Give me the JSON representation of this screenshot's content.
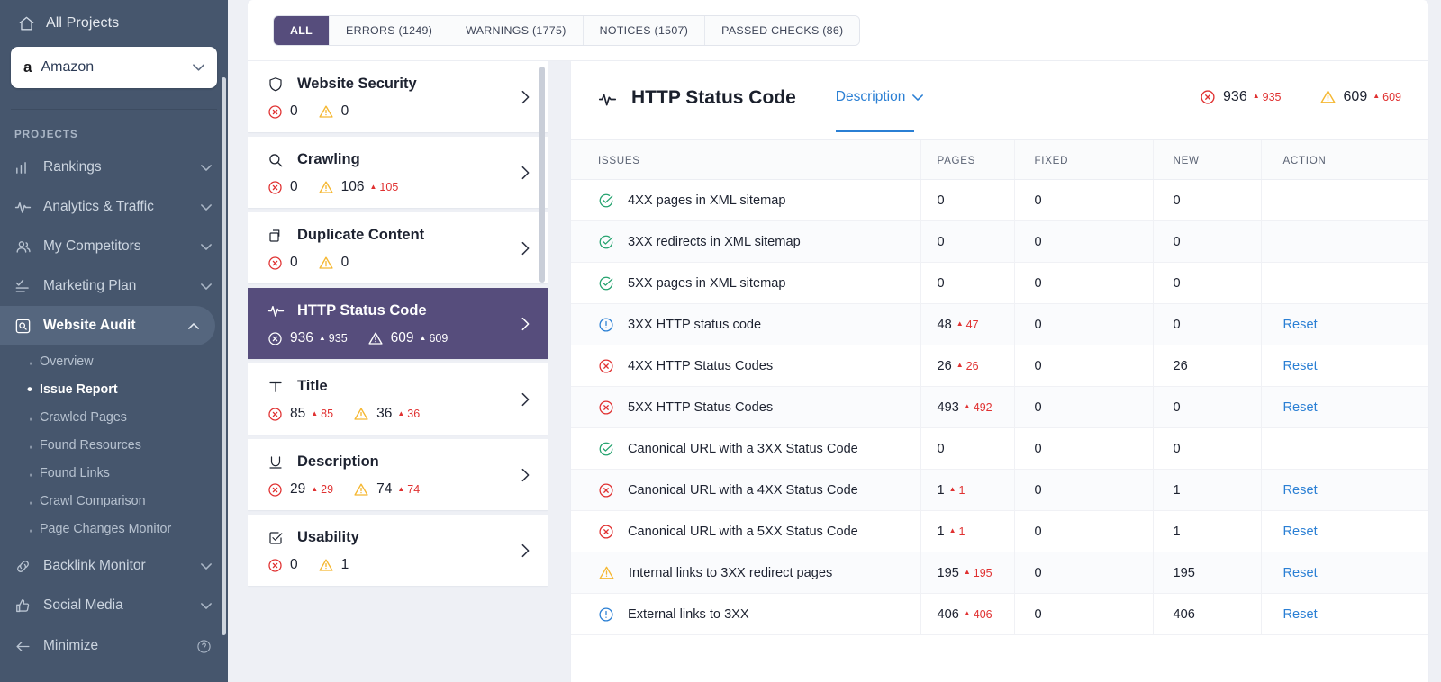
{
  "sidebar": {
    "all_projects_label": "All Projects",
    "project": {
      "name": "Amazon",
      "logo_text": "a"
    },
    "section_label": "PROJECTS",
    "nav": [
      {
        "label": "Rankings",
        "icon": "bar-chart-icon",
        "caret": "⌄"
      },
      {
        "label": "Analytics & Traffic",
        "icon": "pulse-icon",
        "caret": "⌄"
      },
      {
        "label": "My Competitors",
        "icon": "people-icon",
        "caret": "⌄"
      },
      {
        "label": "Marketing Plan",
        "icon": "checklist-icon",
        "caret": "⌄"
      },
      {
        "label": "Website Audit",
        "icon": "audit-search-icon",
        "caret": "⌃"
      }
    ],
    "audit_subnav": [
      {
        "label": "Overview",
        "current": false
      },
      {
        "label": "Issue Report",
        "current": true
      },
      {
        "label": "Crawled Pages",
        "current": false
      },
      {
        "label": "Found Resources",
        "current": false
      },
      {
        "label": "Found Links",
        "current": false
      },
      {
        "label": "Crawl Comparison",
        "current": false
      },
      {
        "label": "Page Changes Monitor",
        "current": false
      }
    ],
    "nav_bottom": [
      {
        "label": "Backlink Monitor",
        "icon": "link-icon",
        "caret": "⌄"
      },
      {
        "label": "Social Media",
        "icon": "thumbs-up-icon",
        "caret": "⌄"
      }
    ],
    "minimize_label": "Minimize",
    "help_icon": "help-circle-icon"
  },
  "tabs": [
    {
      "label": "ALL",
      "active": true
    },
    {
      "label": "ERRORS (1249)",
      "active": false
    },
    {
      "label": "WARNINGS (1775)",
      "active": false
    },
    {
      "label": "NOTICES (1507)",
      "active": false
    },
    {
      "label": "PASSED CHECKS (86)",
      "active": false
    }
  ],
  "categories": [
    {
      "name": "Website Security",
      "icon": "shield-icon",
      "selected": false,
      "errors": "0",
      "errors_delta": "",
      "warnings": "0",
      "warnings_delta": ""
    },
    {
      "name": "Crawling",
      "icon": "magnifier-icon",
      "selected": false,
      "errors": "0",
      "errors_delta": "",
      "warnings": "106",
      "warnings_delta": "105"
    },
    {
      "name": "Duplicate Content",
      "icon": "copy-icon",
      "selected": false,
      "errors": "0",
      "errors_delta": "",
      "warnings": "0",
      "warnings_delta": ""
    },
    {
      "name": "HTTP Status Code",
      "icon": "pulse-icon",
      "selected": true,
      "errors": "936",
      "errors_delta": "935",
      "warnings": "609",
      "warnings_delta": "609"
    },
    {
      "name": "Title",
      "icon": "text-t-icon",
      "selected": false,
      "errors": "85",
      "errors_delta": "85",
      "warnings": "36",
      "warnings_delta": "36"
    },
    {
      "name": "Description",
      "icon": "underline-u-icon",
      "selected": false,
      "errors": "29",
      "errors_delta": "29",
      "warnings": "74",
      "warnings_delta": "74"
    },
    {
      "name": "Usability",
      "icon": "checkbox-icon",
      "selected": false,
      "errors": "0",
      "errors_delta": "",
      "warnings": "1",
      "warnings_delta": ""
    }
  ],
  "detail": {
    "icon": "pulse-icon",
    "title": "HTTP Status Code",
    "tab_label": "Description",
    "errors": "936",
    "errors_delta": "935",
    "warnings": "609",
    "warnings_delta": "609",
    "columns": [
      "ISSUES",
      "PAGES",
      "FIXED",
      "NEW",
      "ACTION"
    ],
    "rows": [
      {
        "status": "ok",
        "issue": "4XX pages in XML sitemap",
        "pages": "0",
        "pages_delta": "",
        "fixed": "0",
        "new": "0",
        "action": ""
      },
      {
        "status": "ok",
        "issue": "3XX redirects in XML sitemap",
        "pages": "0",
        "pages_delta": "",
        "fixed": "0",
        "new": "0",
        "action": ""
      },
      {
        "status": "ok",
        "issue": "5XX pages in XML sitemap",
        "pages": "0",
        "pages_delta": "",
        "fixed": "0",
        "new": "0",
        "action": ""
      },
      {
        "status": "notice",
        "issue": "3XX HTTP status code",
        "pages": "48",
        "pages_delta": "47",
        "fixed": "0",
        "new": "0",
        "action": "Reset"
      },
      {
        "status": "error",
        "issue": "4XX HTTP Status Codes",
        "pages": "26",
        "pages_delta": "26",
        "fixed": "0",
        "new": "26",
        "action": "Reset"
      },
      {
        "status": "error",
        "issue": "5XX HTTP Status Codes",
        "pages": "493",
        "pages_delta": "492",
        "fixed": "0",
        "new": "0",
        "action": "Reset"
      },
      {
        "status": "ok",
        "issue": "Canonical URL with a 3XX Status Code",
        "pages": "0",
        "pages_delta": "",
        "fixed": "0",
        "new": "0",
        "action": ""
      },
      {
        "status": "error",
        "issue": "Canonical URL with a 4XX Status Code",
        "pages": "1",
        "pages_delta": "1",
        "fixed": "0",
        "new": "1",
        "action": "Reset"
      },
      {
        "status": "error",
        "issue": "Canonical URL with a 5XX Status Code",
        "pages": "1",
        "pages_delta": "1",
        "fixed": "0",
        "new": "1",
        "action": "Reset"
      },
      {
        "status": "warning",
        "issue": "Internal links to 3XX redirect pages",
        "pages": "195",
        "pages_delta": "195",
        "fixed": "0",
        "new": "195",
        "action": "Reset"
      },
      {
        "status": "notice",
        "issue": "External links to 3XX",
        "pages": "406",
        "pages_delta": "406",
        "fixed": "0",
        "new": "406",
        "action": "Reset"
      }
    ]
  },
  "colors": {
    "sidebar_bg": "#46566d",
    "accent_purple": "#564d7c",
    "error_red": "#e03131",
    "warning_amber": "#f5b731",
    "ok_green": "#25a36f",
    "notice_blue": "#2a7fd4",
    "link_blue": "#2a7fd4"
  }
}
